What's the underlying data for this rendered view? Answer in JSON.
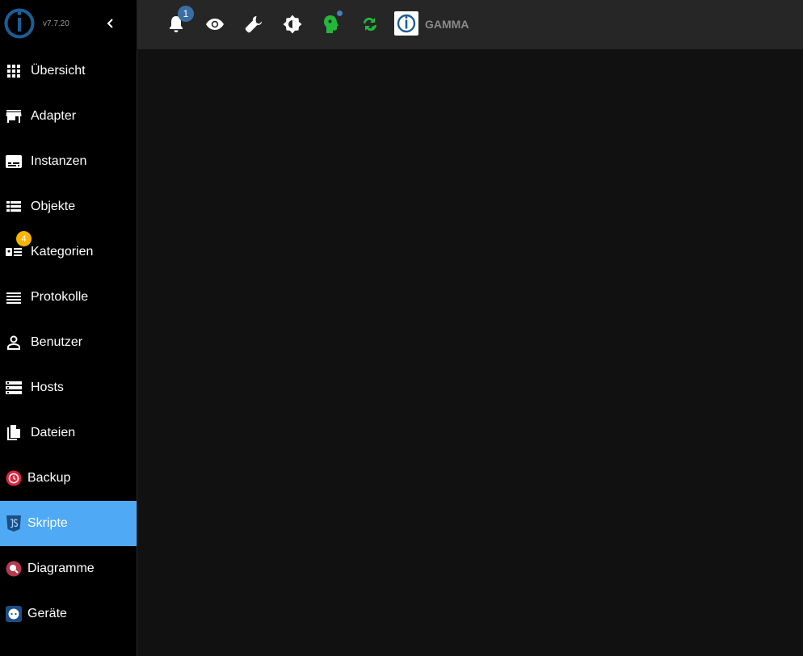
{
  "app": {
    "version": "v7.7.20",
    "host_name": "GAMMA"
  },
  "notifications": {
    "count": "1"
  },
  "nav": {
    "items": [
      {
        "label": "Übersicht",
        "icon": "apps-grid-icon"
      },
      {
        "label": "Adapter",
        "icon": "store-icon"
      },
      {
        "label": "Instanzen",
        "icon": "subtitles-icon"
      },
      {
        "label": "Objekte",
        "icon": "list-view-icon"
      },
      {
        "label": "Kategorien",
        "icon": "category-card-icon"
      },
      {
        "label": "Protokolle",
        "icon": "log-lines-icon",
        "badge": "4"
      },
      {
        "label": "Benutzer",
        "icon": "person-icon"
      },
      {
        "label": "Hosts",
        "icon": "storage-icon"
      },
      {
        "label": "Dateien",
        "icon": "files-icon"
      },
      {
        "label": "Backup",
        "icon": "backup-icon"
      },
      {
        "label": "Skripte",
        "icon": "javascript-icon",
        "active": true
      },
      {
        "label": "Diagramme",
        "icon": "chart-search-icon"
      },
      {
        "label": "Geräte",
        "icon": "devices-icon"
      }
    ]
  },
  "colors": {
    "active": "#4fa9f5",
    "accent_green": "#22b83a",
    "brand_blue": "#1b5e96",
    "badge_yellow": "#f7b500",
    "badge_blue": "#3b6fa3"
  }
}
